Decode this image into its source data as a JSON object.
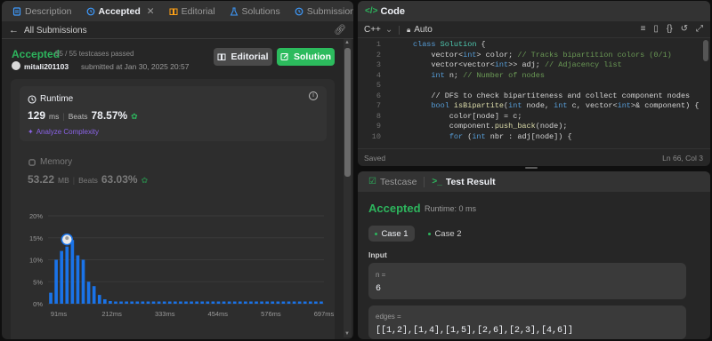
{
  "left": {
    "tabs": [
      {
        "label": "Description"
      },
      {
        "label": "Accepted"
      },
      {
        "label": "Editorial"
      },
      {
        "label": "Solutions"
      },
      {
        "label": "Submissions"
      }
    ],
    "back_label": "All Submissions",
    "status": "Accepted",
    "testcases": "55 / 55 testcases passed",
    "username": "mitali201103",
    "submitted": "submitted at Jan 30, 2025 20:57",
    "editorial_btn": "Editorial",
    "solution_btn": "Solution",
    "runtime": {
      "title": "Runtime",
      "value": "129",
      "unit": "ms",
      "beats_label": "Beats",
      "beats": "78.57%",
      "analyze": "Analyze Complexity"
    },
    "memory": {
      "title": "Memory",
      "value": "53.22",
      "unit": "MB",
      "beats_label": "Beats",
      "beats": "63.03%"
    }
  },
  "chart_data": {
    "type": "bar",
    "y_ticks": [
      "20%",
      "15%",
      "10%",
      "5%",
      "0%"
    ],
    "x_ticks": [
      "91ms",
      "212ms",
      "333ms",
      "454ms",
      "576ms",
      "697ms"
    ],
    "ylim": [
      0,
      20
    ],
    "values": [
      2.5,
      10,
      12,
      13,
      14.5,
      11,
      10,
      5,
      4,
      2,
      1,
      0.6,
      0.5,
      0.5,
      0.5,
      0.5,
      0.5,
      0.5,
      0.5,
      0.5,
      0.5,
      0.5,
      0.5,
      0.5,
      0.5,
      0.5,
      0.5,
      0.5,
      0.5,
      0.5,
      0.5,
      0.5,
      0.5,
      0.5,
      0.5,
      0.5,
      0.5,
      0.5,
      0.5,
      0.5,
      0.5,
      0.5,
      0.5,
      0.5,
      0.5,
      0.5,
      0.5,
      0.5,
      0.5,
      0.5,
      0.5
    ],
    "highlight_index": 3,
    "colors": {
      "bar": "#1a73e8",
      "grid": "#3a3a3a"
    }
  },
  "code_panel": {
    "title": "Code",
    "language": "C++",
    "mode": "Auto",
    "status": "Saved",
    "cursor": "Ln 66, Col 3",
    "lines": [
      {
        "n": "1"
      },
      {
        "n": "2"
      },
      {
        "n": "3"
      },
      {
        "n": "4"
      },
      {
        "n": "5"
      },
      {
        "n": "6"
      },
      {
        "n": "7"
      },
      {
        "n": "8"
      },
      {
        "n": "9"
      },
      {
        "n": "10"
      }
    ],
    "code": {
      "l1a": "class ",
      "l1b": "Solution",
      "l1c": " {",
      "l2a": "    vector<",
      "l2b": "int",
      "l2c": "> color; ",
      "l2d": "// Tracks bipartition colors (0/1)",
      "l3a": "    vector<vector<",
      "l3b": "int",
      "l3c": ">> adj; ",
      "l3d": "// Adjacency list",
      "l4a": "    ",
      "l4b": "int",
      "l4c": " n; ",
      "l4d": "// Number of nodes",
      "l6": "    // DFS to check bipartiteness and collect component nodes",
      "l7a": "    ",
      "l7b": "bool",
      "l7c": " ",
      "l7d": "isBipartite",
      "l7e": "(",
      "l7f": "int",
      "l7g": " node, ",
      "l7h": "int",
      "l7i": " c, vector<",
      "l7j": "int",
      "l7k": ">& component) {",
      "l8": "        color[node] = c;",
      "l9a": "        component.",
      "l9b": "push_back",
      "l9c": "(node);",
      "l10a": "        ",
      "l10b": "for",
      "l10c": " (",
      "l10d": "int",
      "l10e": " nbr : adj[node]) {"
    }
  },
  "result_panel": {
    "tab_testcase": "Testcase",
    "tab_result": "Test Result",
    "status": "Accepted",
    "runtime": "Runtime: 0 ms",
    "case1": "Case 1",
    "case2": "Case 2",
    "input_label": "Input",
    "n_label": "n =",
    "n_value": "6",
    "edges_label": "edges =",
    "edges_value": "[[1,2],[1,4],[1,5],[2,6],[2,3],[4,6]]"
  }
}
